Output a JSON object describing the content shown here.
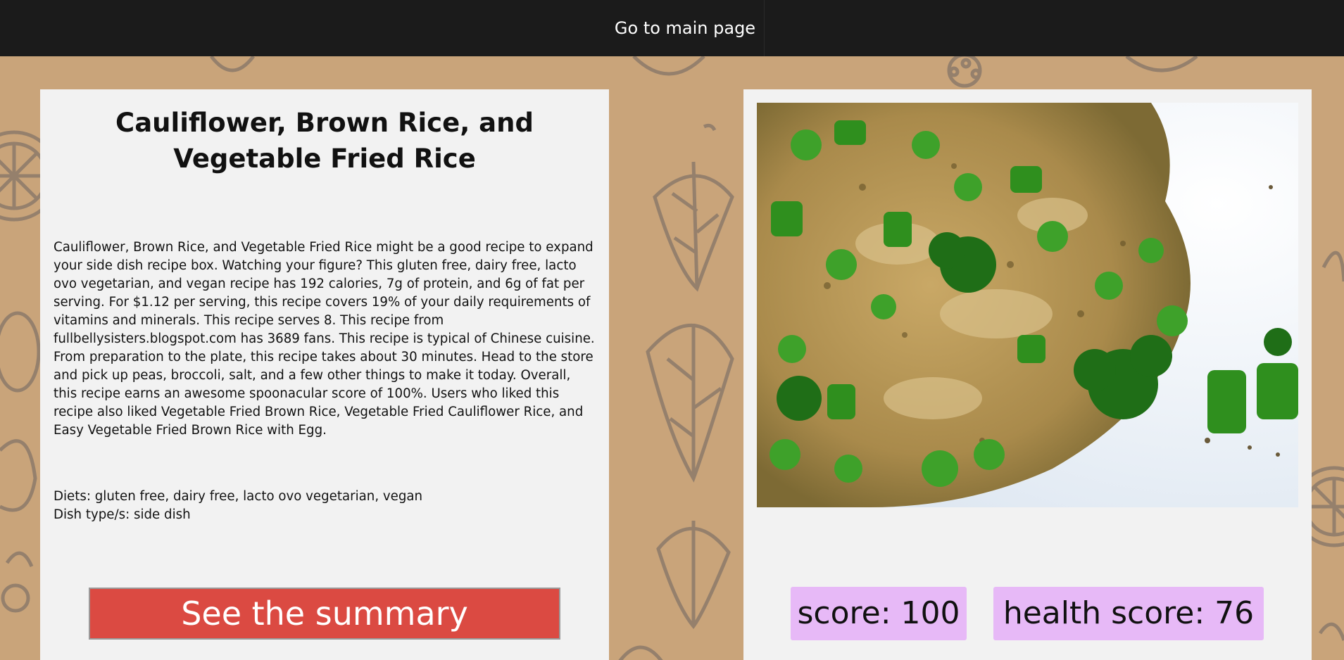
{
  "nav": {
    "main_link": "Go to main page"
  },
  "recipe": {
    "title": "Cauliflower, Brown Rice, and Vegetable Fried Rice",
    "summary": "Cauliflower, Brown Rice, and Vegetable Fried Rice might be a good recipe to expand your side dish recipe box. Watching your figure? This gluten free, dairy free, lacto ovo vegetarian, and vegan recipe has 192 calories, 7g of protein, and 6g of fat per serving. For $1.12 per serving, this recipe covers 19% of your daily requirements of vitamins and minerals. This recipe serves 8. This recipe from fullbellysisters.blogspot.com has 3689 fans. This recipe is typical of Chinese cuisine. From preparation to the plate, this recipe takes about 30 minutes. Head to the store and pick up peas, broccoli, salt, and a few other things to make it today. Overall, this recipe earns an awesome spoonacular score of 100%. Users who liked this recipe also liked Vegetable Fried Brown Rice, Vegetable Fried Cauliflower Rice, and Easy Vegetable Fried Brown Rice with Egg.",
    "diets": "Diets: gluten free, dairy free, lacto ovo vegetarian, vegan",
    "dish_types": "Dish type/s: side dish",
    "summary_button": "See the summary",
    "score": "score: 100",
    "health_score": "health score: 76"
  },
  "colors": {
    "navbar": "#1b1b1b",
    "background": "#c9a47a",
    "card": "#f2f2f2",
    "summary_button": "#db4a42",
    "score_badge": "#e7b9f7"
  }
}
